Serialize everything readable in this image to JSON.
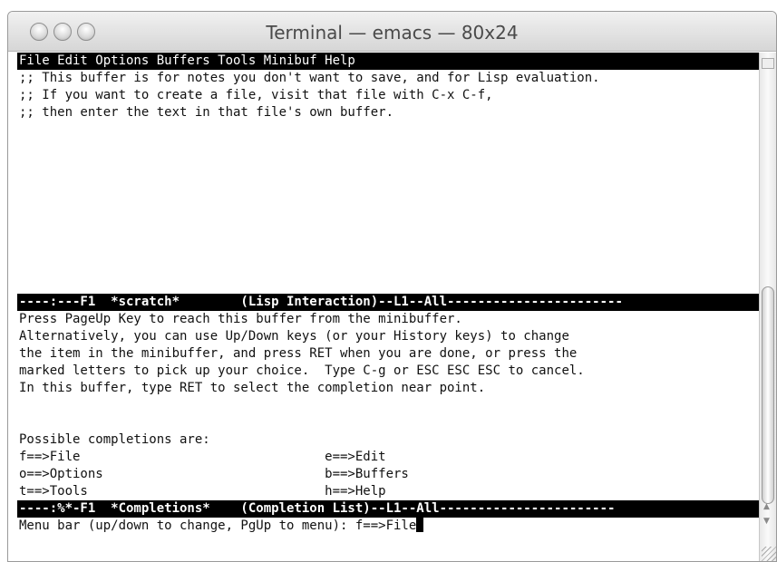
{
  "window": {
    "title": "Terminal — emacs — 80x24"
  },
  "menubar": "File Edit Options Buffers Tools Minibuf Help",
  "scratch_lines": [
    ";; This buffer is for notes you don't want to save, and for Lisp evaluation.",
    ";; If you want to create a file, visit that file with C-x C-f,",
    ";; then enter the text in that file's own buffer."
  ],
  "modeline_scratch": "----:---F1  *scratch*        (Lisp Interaction)--L1--All-----------------------",
  "completions_help": [
    "Press PageUp Key to reach this buffer from the minibuffer.",
    "Alternatively, you can use Up/Down keys (or your History keys) to change",
    "the item in the minibuffer, and press RET when you are done, or press the",
    "marked letters to pick up your choice.  Type C-g or ESC ESC ESC to cancel.",
    "In this buffer, type RET to select the completion near point."
  ],
  "possible_header": "Possible completions are:",
  "completions": [
    "f==>File                                e==>Edit",
    "o==>Options                             b==>Buffers",
    "t==>Tools                               h==>Help"
  ],
  "modeline_completions": "----:%*-F1  *Completions*    (Completion List)--L1--All-----------------------",
  "minibuffer": "Menu bar (up/down to change, PgUp to menu): f==>File"
}
